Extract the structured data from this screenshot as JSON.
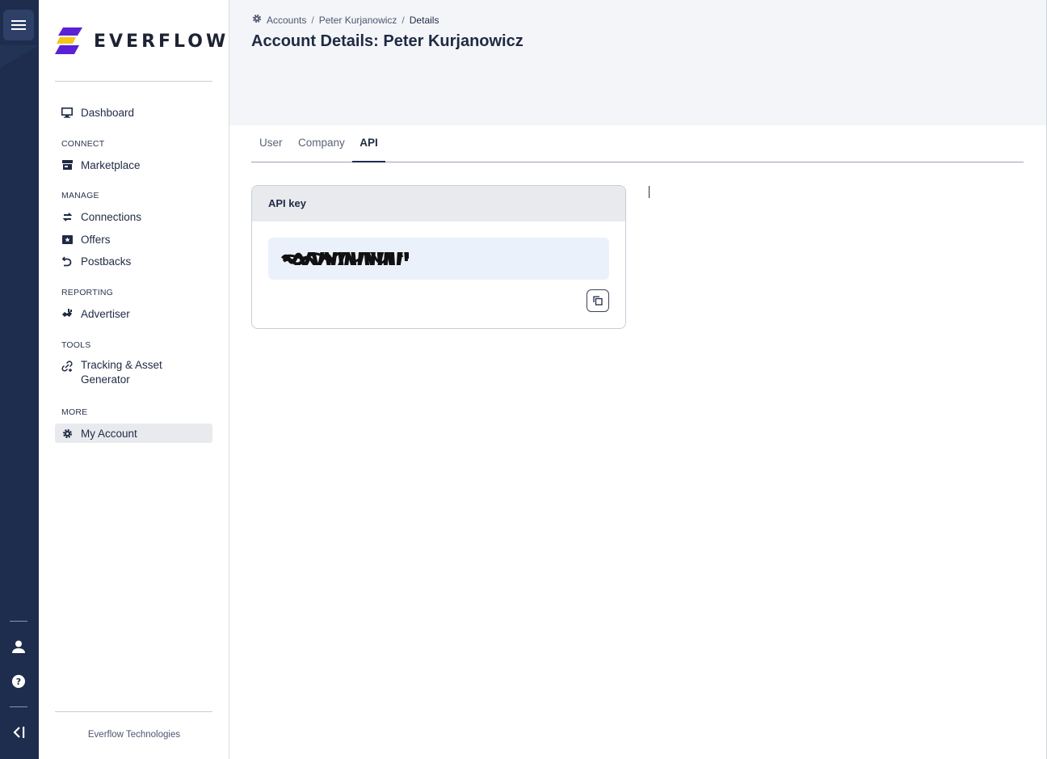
{
  "brand": {
    "name": "EVERFLOW",
    "colors": {
      "purple": "#5b21d6",
      "yellow": "#f5c518",
      "navy": "#1e2d4d"
    }
  },
  "rail": {
    "icons": [
      "menu-icon",
      "user-icon",
      "help-icon",
      "collapse-icon"
    ]
  },
  "sidebar": {
    "dashboard": {
      "label": "Dashboard",
      "icon": "monitor-icon"
    },
    "sections": {
      "connect": "CONNECT",
      "manage": "MANAGE",
      "reporting": "REPORTING",
      "tools": "TOOLS",
      "more": "MORE"
    },
    "items": {
      "marketplace": "Marketplace",
      "connections": "Connections",
      "offers": "Offers",
      "postbacks": "Postbacks",
      "advertiser": "Advertiser",
      "tracking_line1": "Tracking & Asset",
      "tracking_line2": "Generator",
      "my_account": "My Account"
    },
    "footer": "Everflow Technologies"
  },
  "header": {
    "breadcrumb": [
      "Accounts",
      "Peter Kurjanowicz",
      "Details"
    ],
    "title": "Account Details: Peter Kurjanowicz"
  },
  "tabs": {
    "user": "User",
    "company": "Company",
    "api": "API",
    "active": "API"
  },
  "api_card": {
    "title": "API key",
    "value_redacted": true
  }
}
